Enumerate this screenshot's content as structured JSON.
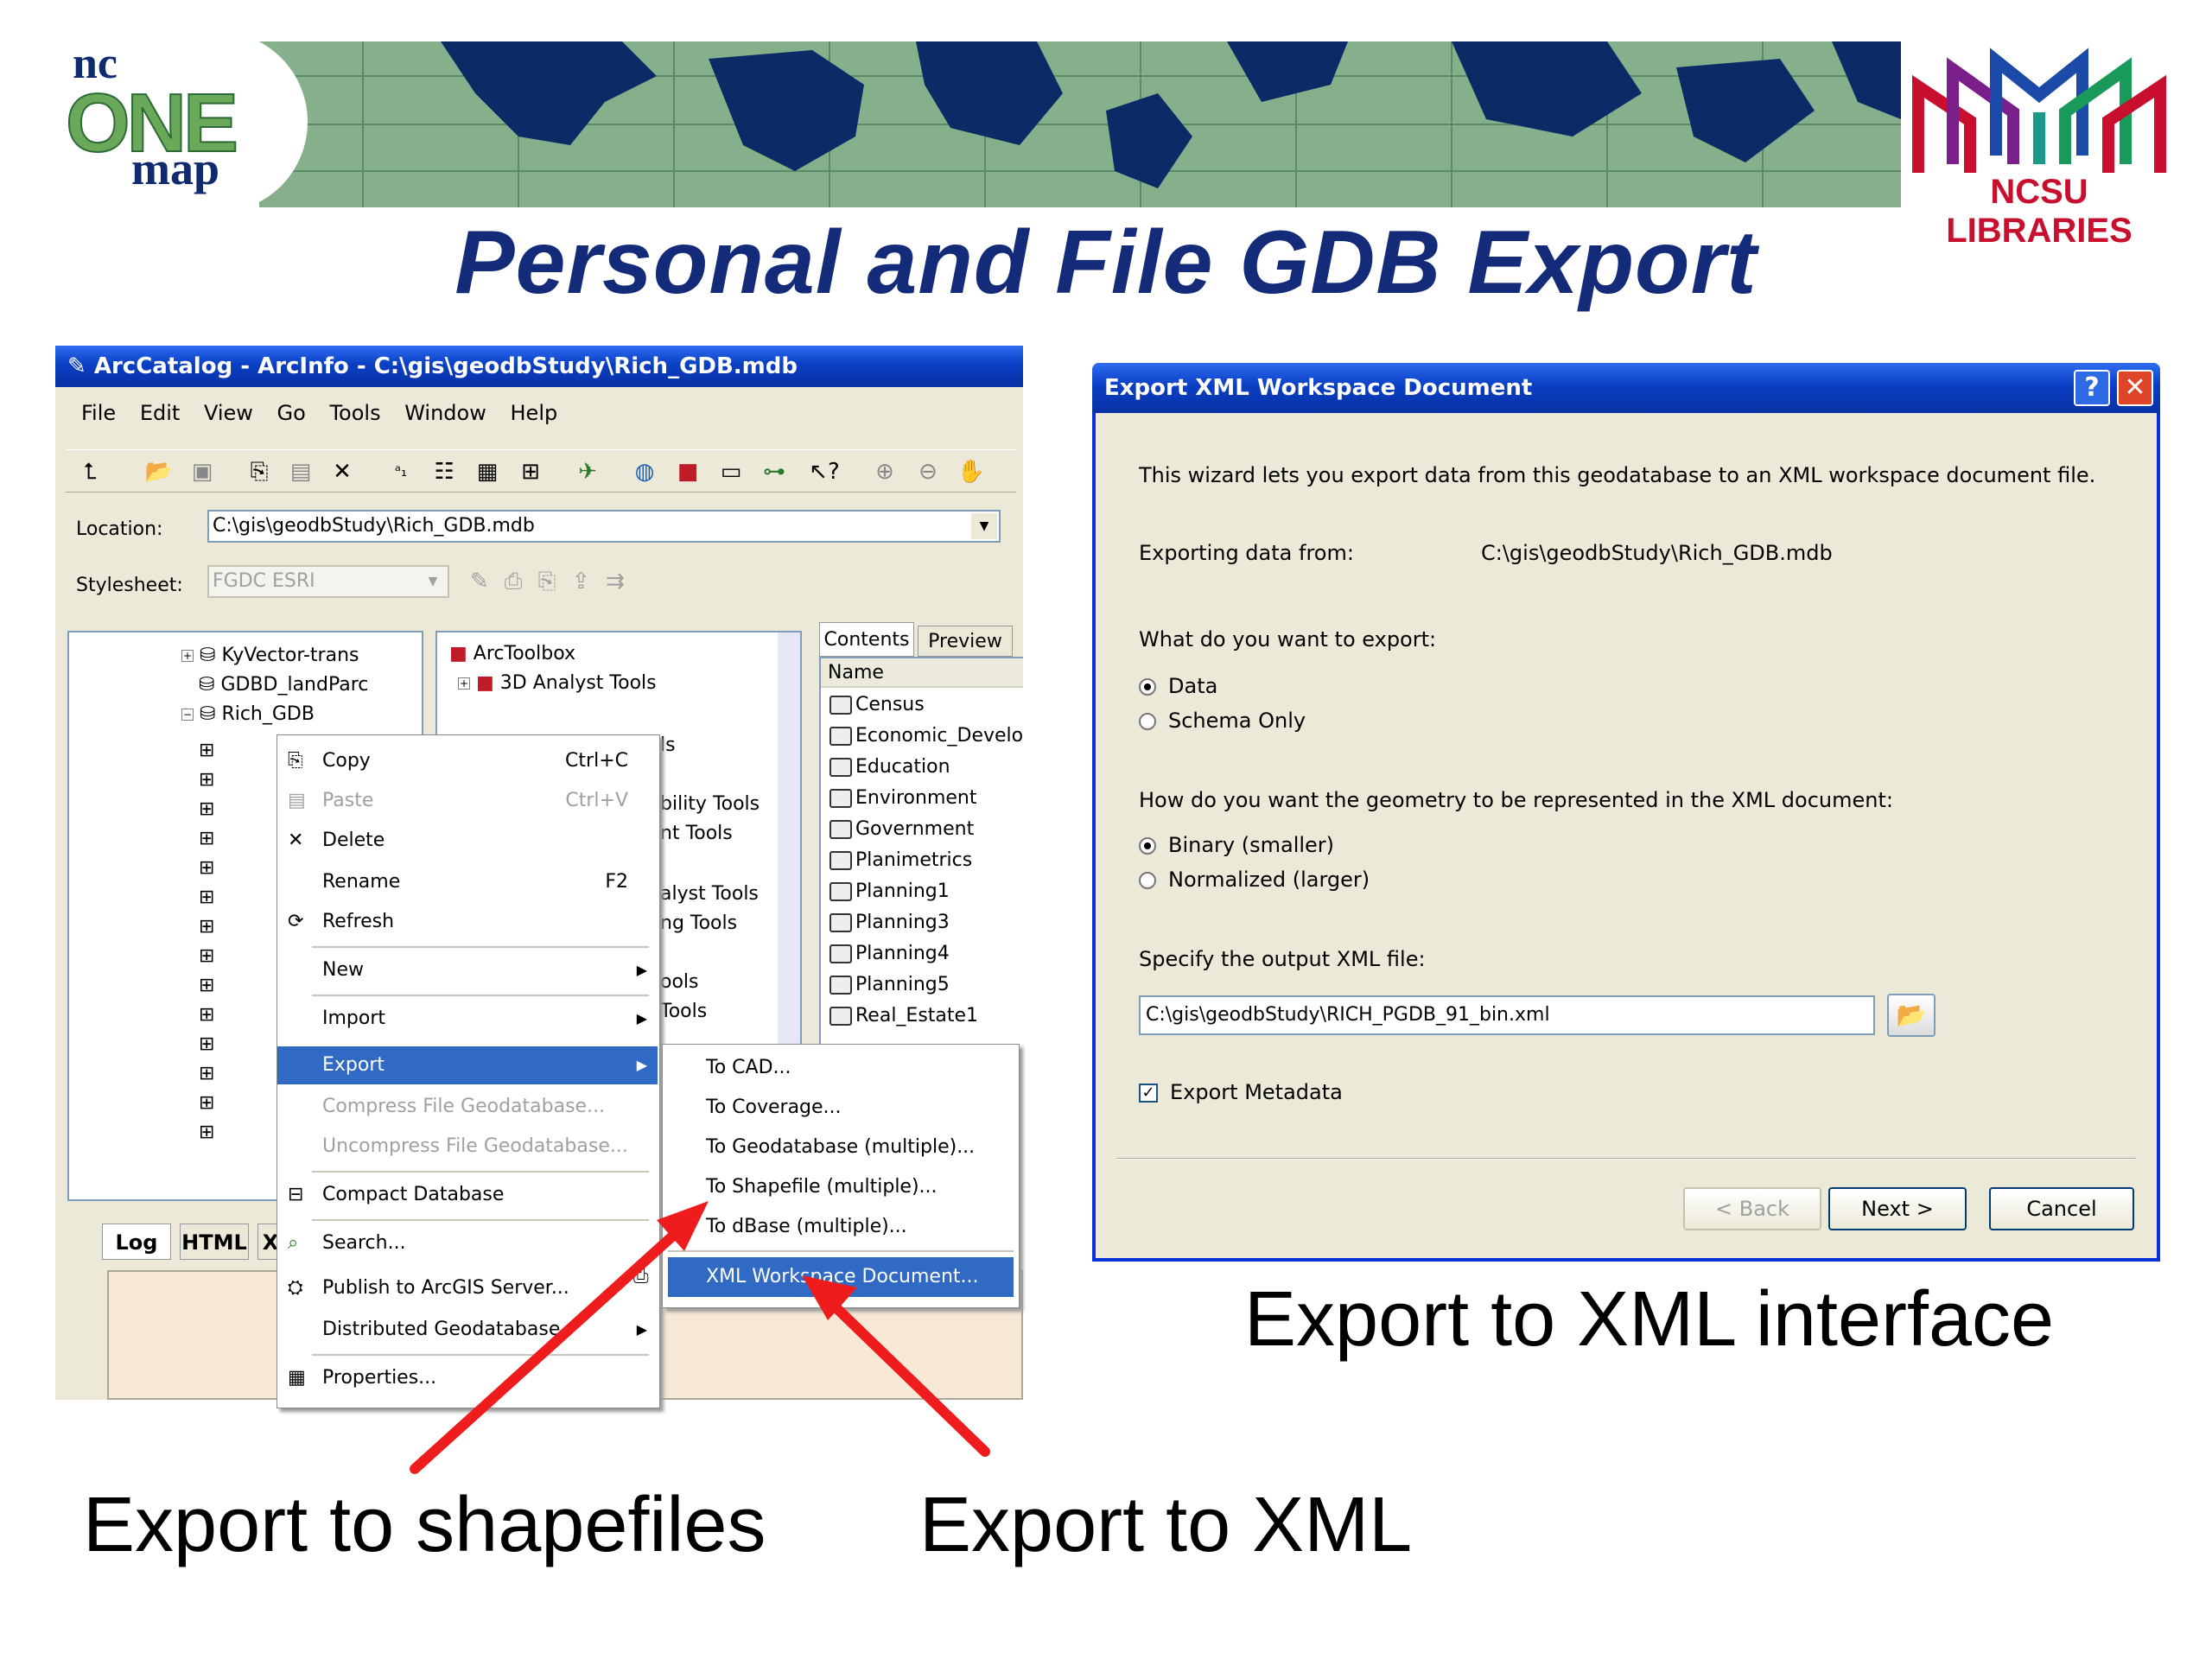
{
  "header": {
    "logo_left_line1": "nc",
    "logo_left_line2": "ONE",
    "logo_left_line3": "map",
    "logo_right_text": "NCSU LIBRARIES",
    "slide_title": "Personal and File GDB Export"
  },
  "arccatalog": {
    "title": "ArcCatalog - ArcInfo - C:\\gis\\geodbStudy\\Rich_GDB.mdb",
    "menu": [
      "File",
      "Edit",
      "View",
      "Go",
      "Tools",
      "Window",
      "Help"
    ],
    "location_label": "Location:",
    "location_value": "C:\\gis\\geodbStudy\\Rich_GDB.mdb",
    "stylesheet_label": "Stylesheet:",
    "stylesheet_value": "FGDC ESRI",
    "tree": [
      "KyVector-trans",
      "GDBD_landParc",
      "Rich_GDB"
    ],
    "toolbox_items": [
      "ArcToolbox",
      "3D Analyst Tools",
      "ls",
      "bility Tools",
      "nt Tools",
      "alyst Tools",
      "ng Tools",
      "ools",
      "Tools"
    ],
    "tabs": [
      "Contents",
      "Preview"
    ],
    "contents_header": "Name",
    "contents_items": [
      "Census",
      "Economic_Develo",
      "Education",
      "Environment",
      "Government",
      "Planimetrics",
      "Planning1",
      "Planning3",
      "Planning4",
      "Planning5",
      "Real_Estate1"
    ],
    "bottom_tabs": [
      "Log",
      "HTML",
      "X"
    ],
    "context_menu": {
      "copy": "Copy",
      "copy_sc": "Ctrl+C",
      "paste": "Paste",
      "paste_sc": "Ctrl+V",
      "delete": "Delete",
      "rename": "Rename",
      "rename_sc": "F2",
      "refresh": "Refresh",
      "new": "New",
      "import": "Import",
      "export": "Export",
      "compress": "Compress File Geodatabase...",
      "uncompress": "Uncompress File Geodatabase...",
      "compact": "Compact Database",
      "search": "Search...",
      "publish": "Publish to ArcGIS Server...",
      "distributed": "Distributed Geodatabase",
      "properties": "Properties..."
    },
    "export_submenu": {
      "to_cad": "To CAD...",
      "to_coverage": "To Coverage...",
      "to_geodatabase": "To Geodatabase (multiple)...",
      "to_shapefile": "To Shapefile (multiple)...",
      "to_dbase": "To dBase (multiple)...",
      "xml": "XML Workspace Document..."
    }
  },
  "dialog": {
    "title": "Export XML Workspace Document",
    "intro": "This wizard lets you export data from this geodatabase to an XML workspace document file.",
    "exporting_label": "Exporting data from:",
    "exporting_value": "C:\\gis\\geodbStudy\\Rich_GDB.mdb",
    "export_question": "What do you want to export:",
    "opt_data": "Data",
    "opt_schema": "Schema Only",
    "geometry_question": "How do you want the geometry to be represented in the XML document:",
    "opt_binary": "Binary (smaller)",
    "opt_normalized": "Normalized (larger)",
    "output_label": "Specify the output XML file:",
    "output_value": "C:\\gis\\geodbStudy\\RICH_PGDB_91_bin.xml",
    "metadata_label": "Export Metadata",
    "back": "< Back",
    "next": "Next >",
    "cancel": "Cancel"
  },
  "captions": {
    "xml_interface": "Export to XML interface",
    "shapefiles": "Export to shapefiles",
    "xml": "Export to XML"
  },
  "colors": {
    "title_blue": "#142b7a",
    "arrow_red": "#ee1c1c",
    "xp_title": "#0a3fc4",
    "menu_sel": "#316ac5"
  }
}
